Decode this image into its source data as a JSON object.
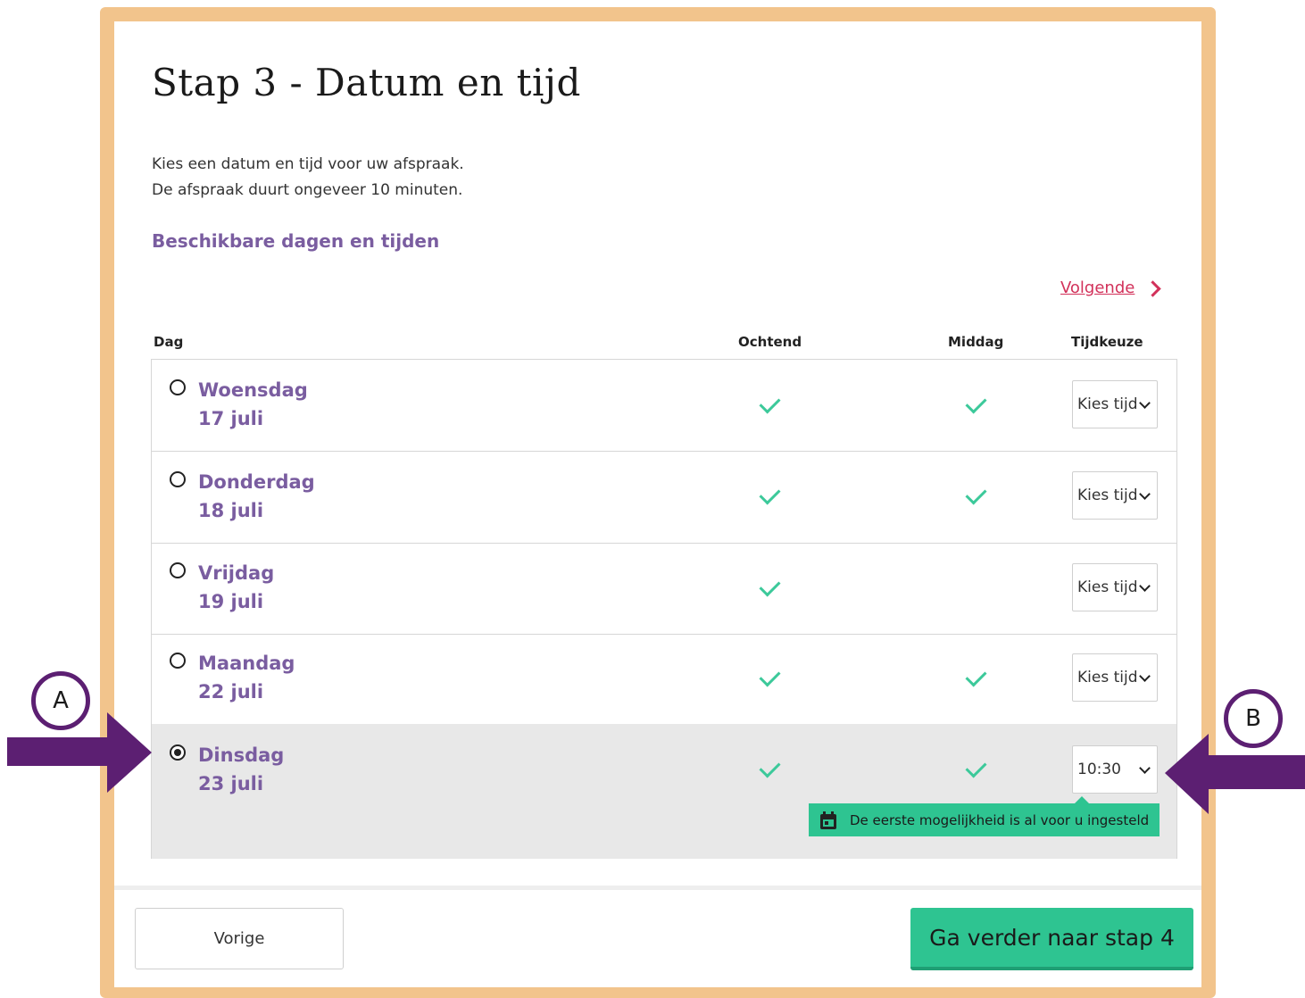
{
  "page": {
    "title": "Stap 3 - Datum en tijd",
    "intro_line1": "Kies een datum en tijd voor uw afspraak.",
    "intro_line2": "De afspraak duurt ongeveer 10 minuten.",
    "subheading": "Beschikbare dagen en tijden",
    "next_link": "Volgende"
  },
  "table": {
    "headers": {
      "day": "Dag",
      "morning": "Ochtend",
      "afternoon": "Middag",
      "time_choice": "Tijdkeuze"
    },
    "rows": [
      {
        "weekday": "Woensdag",
        "date": "17 juli",
        "morning": true,
        "afternoon": true,
        "time": "Kies tijd",
        "selected": false
      },
      {
        "weekday": "Donderdag",
        "date": "18 juli",
        "morning": true,
        "afternoon": true,
        "time": "Kies tijd",
        "selected": false
      },
      {
        "weekday": "Vrijdag",
        "date": "19 juli",
        "morning": true,
        "afternoon": false,
        "time": "Kies tijd",
        "selected": false
      },
      {
        "weekday": "Maandag",
        "date": "22 juli",
        "morning": true,
        "afternoon": true,
        "time": "Kies tijd",
        "selected": false
      },
      {
        "weekday": "Dinsdag",
        "date": "23 juli",
        "morning": true,
        "afternoon": true,
        "time": "10:30",
        "selected": true
      }
    ]
  },
  "tooltip": {
    "text": "De eerste mogelijkheid is al voor u ingesteld",
    "icon": "calendar-icon"
  },
  "footer": {
    "prev_label": "Vorige",
    "next_label": "Ga verder naar stap 4"
  },
  "annotations": {
    "callout_a": "A",
    "callout_b": "B"
  },
  "colors": {
    "frame": "#f2c48c",
    "accent_purple": "#7a5da0",
    "link_red": "#d2315a",
    "green": "#2ec491",
    "check_green": "#3cc99a",
    "arrow_purple": "#5c1f72"
  }
}
